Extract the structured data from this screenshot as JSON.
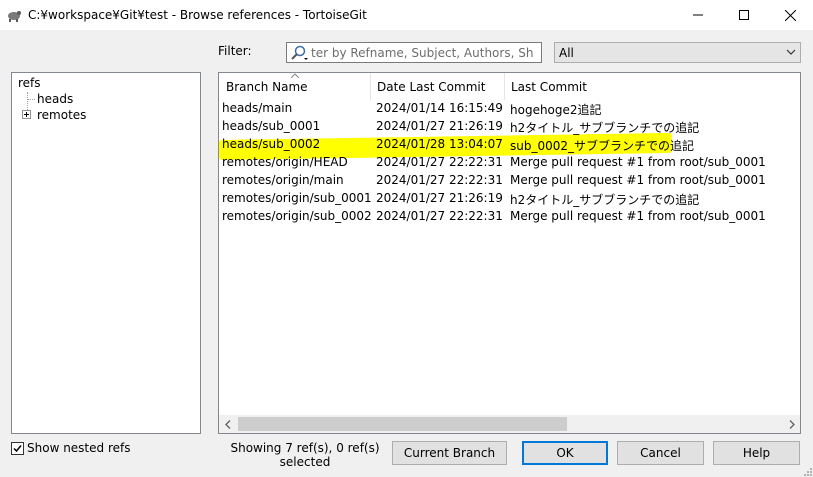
{
  "window": {
    "title": "C:¥workspace¥Git¥test - Browse references - TortoiseGit",
    "icon": "tortoisegit-icon",
    "controls": [
      "minimize-icon",
      "maximize-icon",
      "close-icon"
    ]
  },
  "filter": {
    "label": "Filter:",
    "placeholder": "ter by Refname, Subject, Authors, Sh",
    "scope_selected": "All"
  },
  "tree": {
    "root": "refs",
    "children": [
      {
        "label": "heads",
        "expandable": false
      },
      {
        "label": "remotes",
        "expandable": true
      }
    ]
  },
  "list": {
    "columns": [
      "Branch Name",
      "Date Last Commit",
      "Last Commit"
    ],
    "highlight_color": "#ffff00",
    "rows": [
      {
        "branch": "heads/main",
        "date": "2024/01/14 16:15:49",
        "commit": "hogehoge2追記"
      },
      {
        "branch": "heads/sub_0001",
        "date": "2024/01/27 21:26:19",
        "commit": "h2タイトル_サブブランチでの追記"
      },
      {
        "branch": "heads/sub_0002",
        "date": "2024/01/28 13:04:07",
        "commit": "sub_0002_サブブランチでの追記"
      },
      {
        "branch": "remotes/origin/HEAD",
        "date": "2024/01/27 22:22:31",
        "commit": "Merge pull request #1 from root/sub_0001"
      },
      {
        "branch": "remotes/origin/main",
        "date": "2024/01/27 22:22:31",
        "commit": "Merge pull request #1 from root/sub_0001"
      },
      {
        "branch": "remotes/origin/sub_0001",
        "date": "2024/01/27 21:26:19",
        "commit": "h2タイトル_サブブランチでの追記"
      },
      {
        "branch": "remotes/origin/sub_0002",
        "date": "2024/01/27 22:22:31",
        "commit": "Merge pull request #1 from root/sub_0001"
      }
    ]
  },
  "footer": {
    "show_nested_label": "Show nested refs",
    "show_nested_checked": true,
    "status": "Showing 7 ref(s), 0 ref(s) selected",
    "current_branch_label": "Current Branch",
    "ok_label": "OK",
    "cancel_label": "Cancel",
    "help_label": "Help"
  }
}
